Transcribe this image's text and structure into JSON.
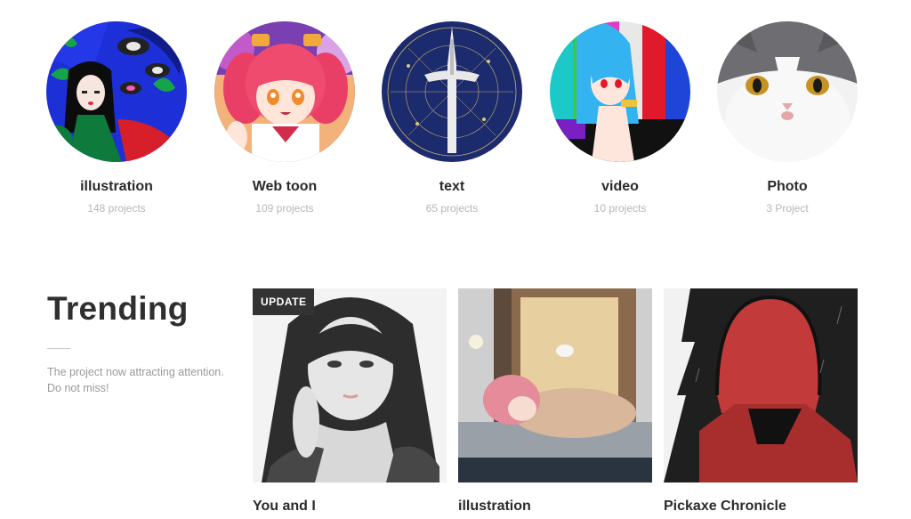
{
  "categories": [
    {
      "name": "illustration",
      "count": "148 projects"
    },
    {
      "name": "Web toon",
      "count": "109 projects"
    },
    {
      "name": "text",
      "count": "65 projects"
    },
    {
      "name": "video",
      "count": "10 projects"
    },
    {
      "name": "Photo",
      "count": "3 Project"
    }
  ],
  "trending": {
    "title": "Trending",
    "description": [
      "The project now attracting attention.",
      "Do not miss!"
    ],
    "cards": [
      {
        "title": "You and I",
        "badge": "UPDATE"
      },
      {
        "title": "illustration"
      },
      {
        "title": "Pickaxe Chronicle"
      }
    ]
  }
}
